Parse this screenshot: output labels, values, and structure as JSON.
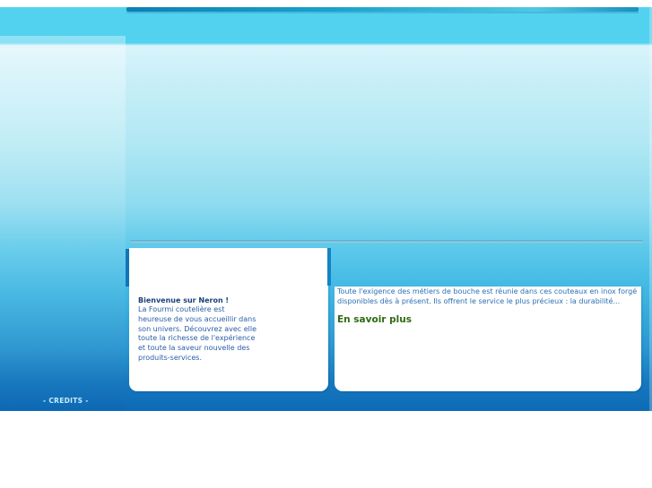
{
  "welcome": {
    "title": "Bienvenue sur Neron !",
    "text": "La Fourmi coutelière est heureuse de vous accueillir dans son univers. Découvrez avec elle toute la richesse de l'expérience et toute la saveur nouvelle des produits-services."
  },
  "promo": {
    "text": "Toute l'exigence des métiers de bouche est réunie dans ces couteaux en inox forgé disponibles dès à présent. Ils offrent le service le plus précieux : la durabilité...",
    "link_label": "En savoir plus"
  },
  "footer": {
    "credits_label": "- CREDITS -"
  },
  "colors": {
    "sky_top": "#52d2ef",
    "sky_bottom": "#0e6ab6",
    "link_green": "#2f6b12",
    "text_blue": "#2a5da6",
    "title_navy": "#1a3f7a"
  }
}
